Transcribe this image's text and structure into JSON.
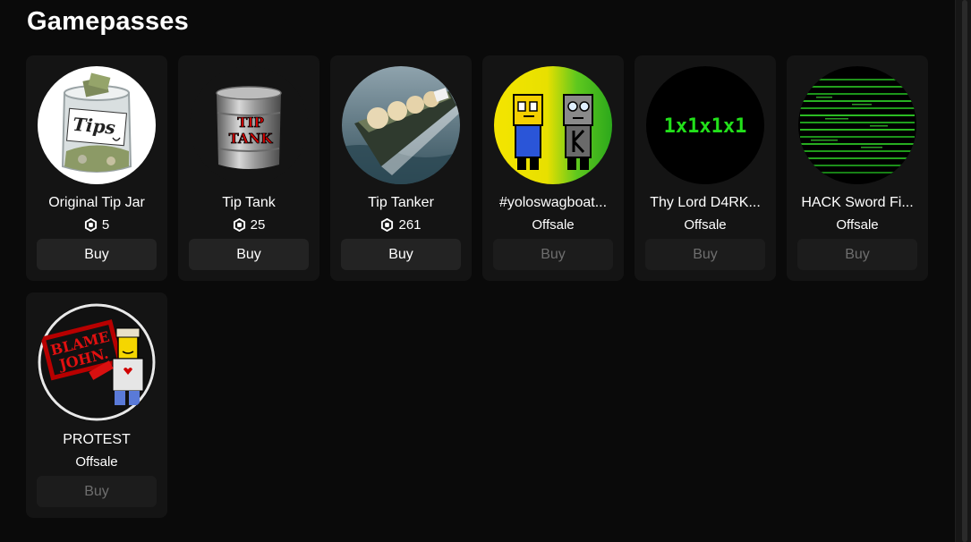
{
  "section": {
    "title": "Gamepasses"
  },
  "passes": [
    {
      "name": "Original Tip Jar",
      "price": "5",
      "buy_label": "Buy",
      "thumb": "tip-jar-image"
    },
    {
      "name": "Tip Tank",
      "price": "25",
      "buy_label": "Buy",
      "thumb": "tip-tank-image"
    },
    {
      "name": "Tip Tanker",
      "price": "261",
      "buy_label": "Buy",
      "thumb": "tanker-ship-image"
    },
    {
      "name": "#yoloswagboat...",
      "price": "Offsale",
      "buy_label": "Buy",
      "thumb": "two-characters-image"
    },
    {
      "name": "Thy Lord D4RK...",
      "price": "Offsale",
      "buy_label": "Buy",
      "thumb": "dark-circle-image"
    },
    {
      "name": "HACK Sword Fi...",
      "price": "Offsale",
      "buy_label": "Buy",
      "thumb": "matrix-code-image"
    },
    {
      "name": "PROTEST",
      "price": "Offsale",
      "buy_label": "Buy",
      "thumb": "blame-john-image"
    }
  ],
  "images": {
    "dark_circle_text": "1x1x1x1",
    "blame_john_text": [
      "BLAME",
      "JOHN."
    ],
    "tip_tank_text": [
      "TIP",
      "TANK"
    ],
    "tip_jar_text": "Tips"
  },
  "colors": {
    "background": "#0a0a0a",
    "card": "#141414",
    "button": "#232323",
    "button_disabled_text": "#6e6e6e"
  }
}
